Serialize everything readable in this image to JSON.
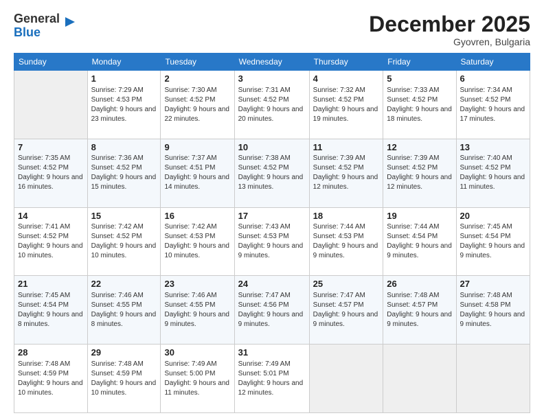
{
  "logo": {
    "general": "General",
    "blue": "Blue"
  },
  "header": {
    "title": "December 2025",
    "location": "Gyovren, Bulgaria"
  },
  "weekdays": [
    "Sunday",
    "Monday",
    "Tuesday",
    "Wednesday",
    "Thursday",
    "Friday",
    "Saturday"
  ],
  "weeks": [
    [
      {
        "day": null
      },
      {
        "day": "1",
        "sunrise": "Sunrise: 7:29 AM",
        "sunset": "Sunset: 4:53 PM",
        "daylight": "Daylight: 9 hours and 23 minutes."
      },
      {
        "day": "2",
        "sunrise": "Sunrise: 7:30 AM",
        "sunset": "Sunset: 4:52 PM",
        "daylight": "Daylight: 9 hours and 22 minutes."
      },
      {
        "day": "3",
        "sunrise": "Sunrise: 7:31 AM",
        "sunset": "Sunset: 4:52 PM",
        "daylight": "Daylight: 9 hours and 20 minutes."
      },
      {
        "day": "4",
        "sunrise": "Sunrise: 7:32 AM",
        "sunset": "Sunset: 4:52 PM",
        "daylight": "Daylight: 9 hours and 19 minutes."
      },
      {
        "day": "5",
        "sunrise": "Sunrise: 7:33 AM",
        "sunset": "Sunset: 4:52 PM",
        "daylight": "Daylight: 9 hours and 18 minutes."
      },
      {
        "day": "6",
        "sunrise": "Sunrise: 7:34 AM",
        "sunset": "Sunset: 4:52 PM",
        "daylight": "Daylight: 9 hours and 17 minutes."
      }
    ],
    [
      {
        "day": "7",
        "sunrise": "Sunrise: 7:35 AM",
        "sunset": "Sunset: 4:52 PM",
        "daylight": "Daylight: 9 hours and 16 minutes."
      },
      {
        "day": "8",
        "sunrise": "Sunrise: 7:36 AM",
        "sunset": "Sunset: 4:52 PM",
        "daylight": "Daylight: 9 hours and 15 minutes."
      },
      {
        "day": "9",
        "sunrise": "Sunrise: 7:37 AM",
        "sunset": "Sunset: 4:51 PM",
        "daylight": "Daylight: 9 hours and 14 minutes."
      },
      {
        "day": "10",
        "sunrise": "Sunrise: 7:38 AM",
        "sunset": "Sunset: 4:52 PM",
        "daylight": "Daylight: 9 hours and 13 minutes."
      },
      {
        "day": "11",
        "sunrise": "Sunrise: 7:39 AM",
        "sunset": "Sunset: 4:52 PM",
        "daylight": "Daylight: 9 hours and 12 minutes."
      },
      {
        "day": "12",
        "sunrise": "Sunrise: 7:39 AM",
        "sunset": "Sunset: 4:52 PM",
        "daylight": "Daylight: 9 hours and 12 minutes."
      },
      {
        "day": "13",
        "sunrise": "Sunrise: 7:40 AM",
        "sunset": "Sunset: 4:52 PM",
        "daylight": "Daylight: 9 hours and 11 minutes."
      }
    ],
    [
      {
        "day": "14",
        "sunrise": "Sunrise: 7:41 AM",
        "sunset": "Sunset: 4:52 PM",
        "daylight": "Daylight: 9 hours and 10 minutes."
      },
      {
        "day": "15",
        "sunrise": "Sunrise: 7:42 AM",
        "sunset": "Sunset: 4:52 PM",
        "daylight": "Daylight: 9 hours and 10 minutes."
      },
      {
        "day": "16",
        "sunrise": "Sunrise: 7:42 AM",
        "sunset": "Sunset: 4:53 PM",
        "daylight": "Daylight: 9 hours and 10 minutes."
      },
      {
        "day": "17",
        "sunrise": "Sunrise: 7:43 AM",
        "sunset": "Sunset: 4:53 PM",
        "daylight": "Daylight: 9 hours and 9 minutes."
      },
      {
        "day": "18",
        "sunrise": "Sunrise: 7:44 AM",
        "sunset": "Sunset: 4:53 PM",
        "daylight": "Daylight: 9 hours and 9 minutes."
      },
      {
        "day": "19",
        "sunrise": "Sunrise: 7:44 AM",
        "sunset": "Sunset: 4:54 PM",
        "daylight": "Daylight: 9 hours and 9 minutes."
      },
      {
        "day": "20",
        "sunrise": "Sunrise: 7:45 AM",
        "sunset": "Sunset: 4:54 PM",
        "daylight": "Daylight: 9 hours and 9 minutes."
      }
    ],
    [
      {
        "day": "21",
        "sunrise": "Sunrise: 7:45 AM",
        "sunset": "Sunset: 4:54 PM",
        "daylight": "Daylight: 9 hours and 8 minutes."
      },
      {
        "day": "22",
        "sunrise": "Sunrise: 7:46 AM",
        "sunset": "Sunset: 4:55 PM",
        "daylight": "Daylight: 9 hours and 8 minutes."
      },
      {
        "day": "23",
        "sunrise": "Sunrise: 7:46 AM",
        "sunset": "Sunset: 4:55 PM",
        "daylight": "Daylight: 9 hours and 9 minutes."
      },
      {
        "day": "24",
        "sunrise": "Sunrise: 7:47 AM",
        "sunset": "Sunset: 4:56 PM",
        "daylight": "Daylight: 9 hours and 9 minutes."
      },
      {
        "day": "25",
        "sunrise": "Sunrise: 7:47 AM",
        "sunset": "Sunset: 4:57 PM",
        "daylight": "Daylight: 9 hours and 9 minutes."
      },
      {
        "day": "26",
        "sunrise": "Sunrise: 7:48 AM",
        "sunset": "Sunset: 4:57 PM",
        "daylight": "Daylight: 9 hours and 9 minutes."
      },
      {
        "day": "27",
        "sunrise": "Sunrise: 7:48 AM",
        "sunset": "Sunset: 4:58 PM",
        "daylight": "Daylight: 9 hours and 9 minutes."
      }
    ],
    [
      {
        "day": "28",
        "sunrise": "Sunrise: 7:48 AM",
        "sunset": "Sunset: 4:59 PM",
        "daylight": "Daylight: 9 hours and 10 minutes."
      },
      {
        "day": "29",
        "sunrise": "Sunrise: 7:48 AM",
        "sunset": "Sunset: 4:59 PM",
        "daylight": "Daylight: 9 hours and 10 minutes."
      },
      {
        "day": "30",
        "sunrise": "Sunrise: 7:49 AM",
        "sunset": "Sunset: 5:00 PM",
        "daylight": "Daylight: 9 hours and 11 minutes."
      },
      {
        "day": "31",
        "sunrise": "Sunrise: 7:49 AM",
        "sunset": "Sunset: 5:01 PM",
        "daylight": "Daylight: 9 hours and 12 minutes."
      },
      {
        "day": null
      },
      {
        "day": null
      },
      {
        "day": null
      }
    ]
  ]
}
